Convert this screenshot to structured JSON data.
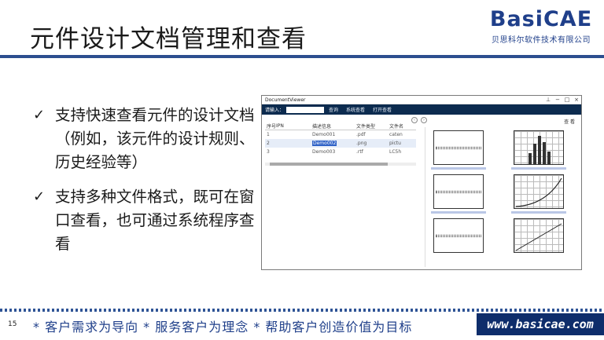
{
  "slide": {
    "title": "元件设计文档管理和查看",
    "brand_logo": "BasiCAE",
    "brand_sub": "贝思科尔软件技术有限公司"
  },
  "bullets": [
    {
      "check": "✓",
      "text": "支持快速查看元件的设计文档（例如，该元件的设计规则、历史经验等）"
    },
    {
      "check": "✓",
      "text": "支持多种文件格式，既可在窗口查看，也可通过系统程序查看"
    }
  ],
  "app": {
    "window_title": "DocumentViewer",
    "controls": [
      "⊥",
      "−",
      "□",
      "×"
    ],
    "search_label": "请输入：",
    "toolbar_buttons": [
      "查询",
      "系统查看",
      "打开查看"
    ],
    "columns": [
      "序号",
      "IPN",
      "描述信息",
      "文件类型",
      "文件名"
    ],
    "rows": [
      {
        "idx": "1",
        "ipn": "",
        "desc": "Demo001",
        "type": ".pdf",
        "name": "caten"
      },
      {
        "idx": "2",
        "ipn": "",
        "desc": "Demo002",
        "type": ".png",
        "name": "pictu"
      },
      {
        "idx": "3",
        "ipn": "",
        "desc": "Demo003",
        "type": ".rtf",
        "name": "LC5h"
      }
    ],
    "selected_row": 2,
    "preview_label": "查 看",
    "nav": [
      "‹",
      "›"
    ]
  },
  "footer": {
    "page_number": "15",
    "slogan": "* 客户需求为导向 * 服务客户为理念 * 帮助客户创造价值为目标",
    "url": "www.basicae.com"
  },
  "colors": {
    "brand_blue": "#1f3f8a",
    "toolbar_navy": "#0c2b4f",
    "selection_blue": "#2f62c7"
  }
}
